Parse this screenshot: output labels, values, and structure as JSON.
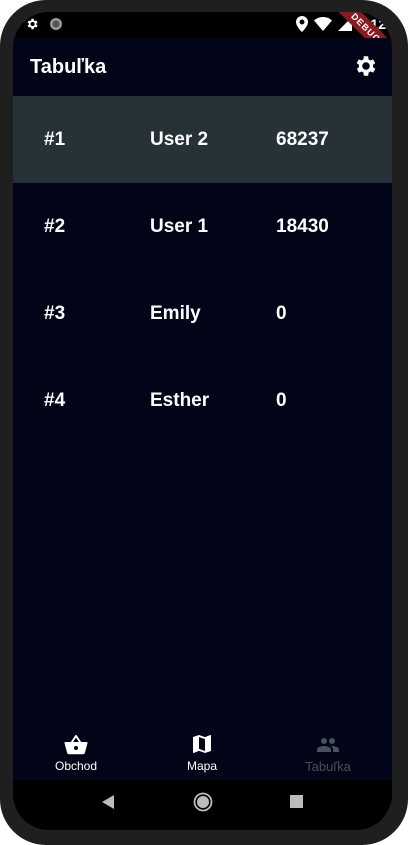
{
  "status_bar": {
    "time": "1:12",
    "debug_label": "DEBUG"
  },
  "app_bar": {
    "title": "Tabuľka"
  },
  "leaderboard": [
    {
      "rank": "#1",
      "name": "User 2",
      "score": "68237"
    },
    {
      "rank": "#2",
      "name": "User 1",
      "score": "18430"
    },
    {
      "rank": "#3",
      "name": "Emily",
      "score": "0"
    },
    {
      "rank": "#4",
      "name": "Esther",
      "score": "0"
    }
  ],
  "bottom_nav": {
    "items": [
      {
        "label": "Obchod",
        "icon": "shopping-basket-icon",
        "active": true
      },
      {
        "label": "Mapa",
        "icon": "map-icon",
        "active": true
      },
      {
        "label": "Tabuľka",
        "icon": "people-icon",
        "active": false
      }
    ]
  },
  "colors": {
    "background": "#020417",
    "highlight_row": "#263238",
    "inactive_nav": "#4a5058",
    "debug_banner": "#8a1a22"
  }
}
